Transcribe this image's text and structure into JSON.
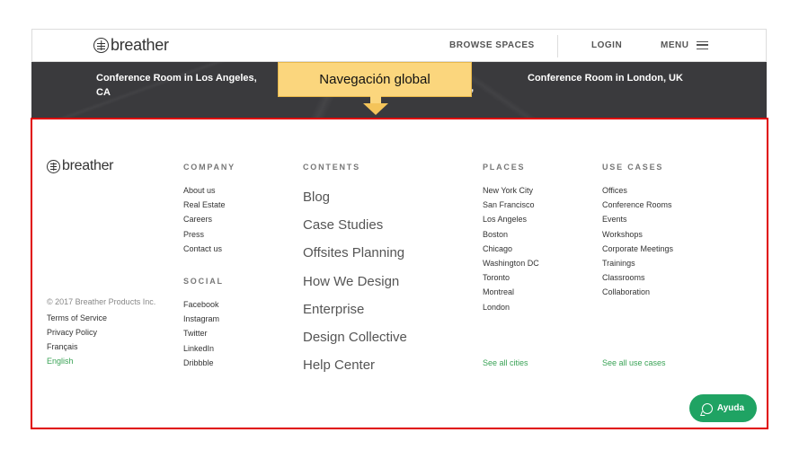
{
  "header": {
    "logo_text": "breather",
    "browse_spaces": "BROWSE SPACES",
    "login": "LOGIN",
    "menu": "MENU"
  },
  "featured_rooms": [
    {
      "line1": "Conference Room in Los Angeles,",
      "line2": "CA"
    },
    {
      "line1": "Conference Room in London, UK",
      "line2": ""
    }
  ],
  "featured_fragment": ",",
  "annotation": {
    "label": "Navegación global",
    "highlight_color": "#e00000",
    "callout_color": "#fbd67d"
  },
  "footer": {
    "logo_text": "breather",
    "company": {
      "heading": "COMPANY",
      "items": [
        "About us",
        "Real Estate",
        "Careers",
        "Press",
        "Contact us"
      ]
    },
    "social": {
      "heading": "SOCIAL",
      "items": [
        "Facebook",
        "Instagram",
        "Twitter",
        "LinkedIn",
        "Dribbble"
      ]
    },
    "contents": {
      "heading": "CONTENTS",
      "items": [
        "Blog",
        "Case Studies",
        "Offsites Planning",
        "How We Design",
        "Enterprise",
        "Design Collective",
        "Help Center"
      ]
    },
    "places": {
      "heading": "PLACES",
      "items": [
        "New York City",
        "San Francisco",
        "Los Angeles",
        "Boston",
        "Chicago",
        "Washington DC",
        "Toronto",
        "Montreal",
        "London"
      ],
      "see_all": "See all cities"
    },
    "use_cases": {
      "heading": "USE CASES",
      "items": [
        "Offices",
        "Conference Rooms",
        "Events",
        "Workshops",
        "Corporate Meetings",
        "Trainings",
        "Classrooms",
        "Collaboration"
      ],
      "see_all": "See all use cases"
    },
    "copyright": "© 2017 Breather Products Inc.",
    "legal_links": [
      "Terms of Service",
      "Privacy Policy",
      "Français",
      "English"
    ],
    "accent_color": "#3aa356"
  },
  "help_button": {
    "label": "Ayuda",
    "color": "#1fa363"
  }
}
